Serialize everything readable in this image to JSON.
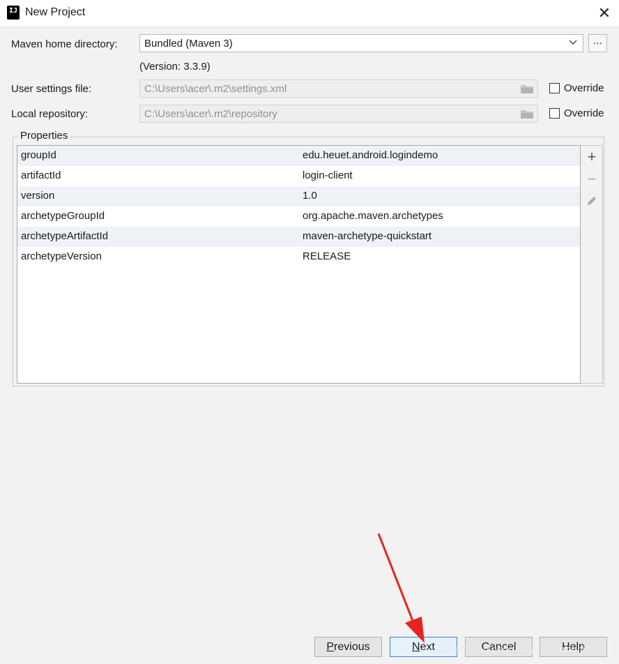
{
  "window": {
    "title": "New Project",
    "close_label": "✕"
  },
  "maven": {
    "home_label": "Maven home directory:",
    "home_value": "Bundled (Maven 3)",
    "browse_label": "...",
    "version_text": "(Version: 3.3.9)",
    "settings_label": "User settings file:",
    "settings_value": "C:\\Users\\acer\\.m2\\settings.xml",
    "settings_override": "Override",
    "repo_label": "Local repository:",
    "repo_value": "C:\\Users\\acer\\.m2\\repository",
    "repo_override": "Override"
  },
  "properties": {
    "title": "Properties",
    "rows": [
      {
        "key": "groupId",
        "value": "edu.heuet.android.logindemo"
      },
      {
        "key": "artifactId",
        "value": "login-client"
      },
      {
        "key": "version",
        "value": "1.0"
      },
      {
        "key": "archetypeGroupId",
        "value": "org.apache.maven.archetypes"
      },
      {
        "key": "archetypeArtifactId",
        "value": "maven-archetype-quickstart"
      },
      {
        "key": "archetypeVersion",
        "value": "RELEASE"
      }
    ]
  },
  "buttons": {
    "previous_u": "P",
    "previous_rest": "revious",
    "next_u": "N",
    "next_rest": "ext",
    "cancel": "Cancel",
    "help": "Help"
  },
  "watermark": "https://blog.csdn.net/midnight_time",
  "colors": {
    "accent": "#3c7fd9",
    "arrow": "#e8231f",
    "row_alt": "#eef2f7"
  }
}
